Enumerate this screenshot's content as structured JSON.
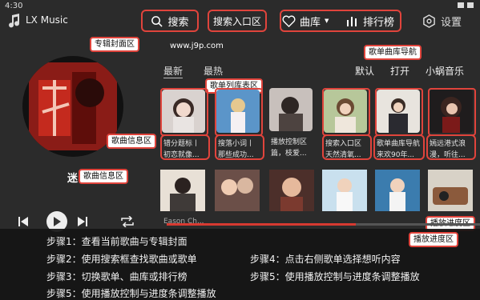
{
  "status": {
    "time": "4:30"
  },
  "app": {
    "title": "LX Music"
  },
  "header": {
    "search_label": "搜索",
    "search_entry_label": "搜索入口区",
    "library_label": "曲库",
    "rank_label": "排行榜",
    "settings_label": "设置"
  },
  "watermark": "www.j9p.com",
  "annotations": {
    "album_cover": "专辑封面区",
    "song_info_1": "歌曲信息区",
    "song_info_2": "歌曲信息区",
    "playlist_area": "歌单列库表区",
    "nav": "歌单曲库导航",
    "progress_1": "播放进度区",
    "progress_2": "播放进度区"
  },
  "tabs": {
    "newest": "最新",
    "hottest": "最热",
    "sources": [
      "默认",
      "打开",
      "小蜗音乐"
    ]
  },
  "row1": [
    {
      "line1": "错分题标丨",
      "line2": "初恋就像..."
    },
    {
      "line1": "搜落小词丨",
      "line2": "那些成功..."
    },
    {
      "line1": "播放控制区",
      "line2": "篇，枝爱..."
    },
    {
      "line1": "搜索入口区",
      "line2": "天然清氧..."
    },
    {
      "line1": "歌单曲库导航",
      "line2": "来欢90年..."
    },
    {
      "line1": "嫣远港式浪",
      "line2": "漫，听往..."
    }
  ],
  "player": {
    "artist": "Eason Ch...",
    "progress": 0.6
  },
  "steps": {
    "s1": "步骤1：查看当前歌曲与专辑封面",
    "s2": "步骤2：使用搜索框查找歌曲或歌单",
    "s3": "步骤3：切换歌单、曲库或排行榜",
    "s4": "步骤4：点击右侧歌单选择想听内容",
    "s5a": "步骤5：使用播放控制与进度条调整播放",
    "s5b": "步骤5：使用播放控制与进度条调整播放"
  },
  "colors": {
    "accent": "#e0443c",
    "bg": "#2b2b2b"
  }
}
